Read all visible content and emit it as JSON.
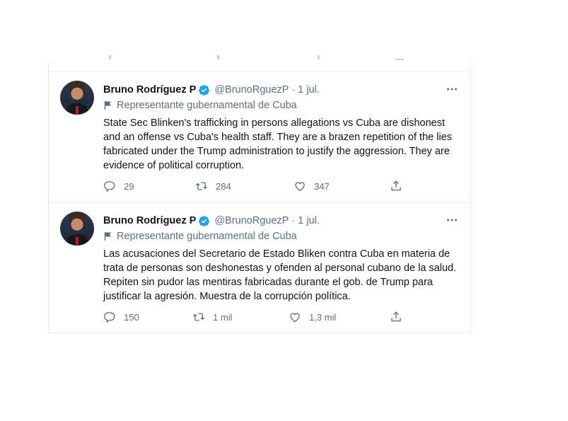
{
  "tweets": [
    {
      "author_name": "Bruno Rodríguez P",
      "handle": "@BrunoRguezP",
      "separator": "·",
      "date": "1 jul.",
      "gov_label": "Representante gubernamental de Cuba",
      "text": "State Sec Blinken's trafficking in persons allegations vs Cuba are dishonest and an offense vs Cuba's health staff. They are a brazen repetition of the lies fabricated under the Trump administration to justify the aggression. They are evidence of political corruption.",
      "replies": "29",
      "retweets": "284",
      "likes": "347"
    },
    {
      "author_name": "Bruno Rodríguez P",
      "handle": "@BrunoRguezP",
      "separator": "·",
      "date": "1 jul.",
      "gov_label": "Representante gubernamental de Cuba",
      "text": "Las acusaciones del Secretario de Estado Bliken contra Cuba en materia de trata de personas son deshonestas y ofenden al personal cubano de la salud. Repiten sin pudor las mentiras fabricadas durante el gob. de Trump para justificar la agresión. Muestra de la corrupción política.",
      "replies": "150",
      "retweets": "1 mil",
      "likes": "1,3 mil"
    }
  ],
  "icons": {
    "verified": "verified-badge-icon",
    "flag": "flag-icon",
    "more": "more-options-icon",
    "reply": "reply-icon",
    "retweet": "retweet-icon",
    "like": "heart-icon",
    "share": "share-icon"
  },
  "colors": {
    "verified": "#1da1f2",
    "secondary_text": "#5b7083",
    "border": "#e6ecf0"
  }
}
